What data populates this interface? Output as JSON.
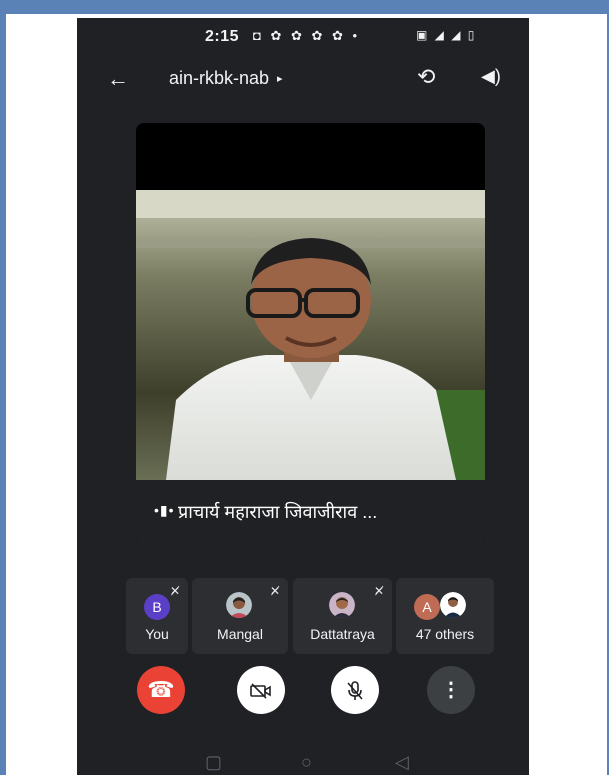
{
  "status_bar": {
    "time": "2:15",
    "notif_icons": "◘ ✿ ✿ ✿ ✿ •",
    "system_icons": "▣ ◢ ◢ ▯"
  },
  "app_bar": {
    "meeting_code": "ain-rkbk-nab",
    "caret": "▸"
  },
  "main_video": {
    "speaker_name": "प्राचार्य महाराजा जिवाजीराव ...",
    "audio_indicator": "•▮•"
  },
  "participants": [
    {
      "name": "You",
      "avatar_letter": "B",
      "avatar_color": "#5b3fc7",
      "muted": true
    },
    {
      "name": "Mangal",
      "avatar_letter": "",
      "muted": true
    },
    {
      "name": "Dattatraya",
      "avatar_letter": "",
      "muted": true
    },
    {
      "name": "47 others",
      "avatar_letter": "A",
      "avatar_color": "#c06b53",
      "muted": false
    }
  ],
  "controls": {
    "end_call": "hang-up-icon",
    "camera": "camera-off-icon",
    "mic": "mic-off-icon",
    "more": "more-icon"
  },
  "colors": {
    "end_call": "#ea4335",
    "control_light": "#ffffff",
    "more_bg": "#3c4043"
  }
}
